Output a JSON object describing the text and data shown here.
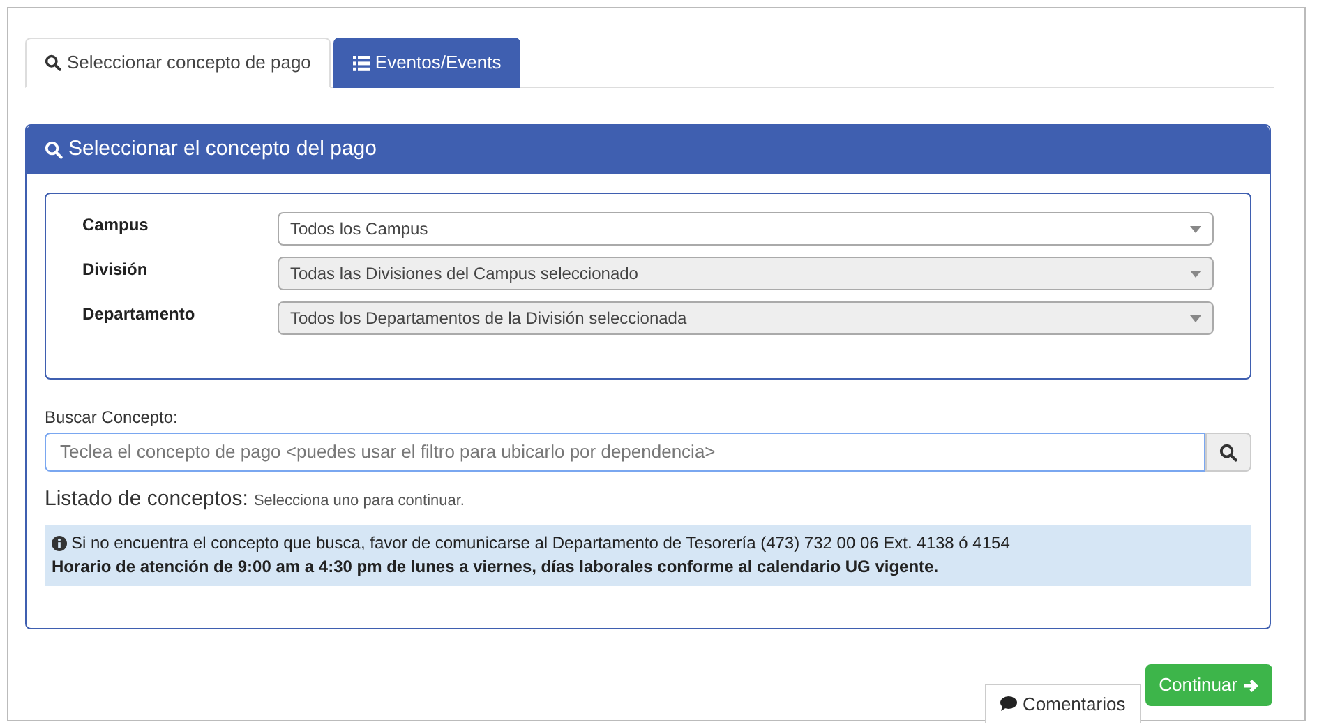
{
  "tabs": [
    {
      "label": "Seleccionar concepto de pago",
      "selected": true
    },
    {
      "label": "Eventos/Events",
      "selected": false
    }
  ],
  "panel": {
    "title": "Seleccionar el concepto del pago",
    "filters": [
      {
        "label": "Campus",
        "value": "Todos los Campus",
        "disabled": false
      },
      {
        "label": "División",
        "value": "Todas las Divisiones del Campus seleccionado",
        "disabled": true
      },
      {
        "label": "Departamento",
        "value": "Todos los Departamentos de la División seleccionada",
        "disabled": true
      }
    ],
    "search": {
      "label": "Buscar Concepto:",
      "placeholder": "Teclea el concepto de pago <puedes usar el filtro para ubicarlo por dependencia>"
    },
    "list_heading": "Listado de conceptos:",
    "list_hint": "Selecciona uno para continuar.",
    "notice": [
      "Si no encuentra el concepto que busca, favor de comunicarse al Departamento de Tesorería (473) 732 00 06 Ext. 4138 ó 4154",
      "Horario de atención de 9:00 am a 4:30 pm de lunes a viernes, días laborales conforme al calendario UG vigente."
    ]
  },
  "continue_button": "Continuar",
  "comments_button": "Comentarios"
}
